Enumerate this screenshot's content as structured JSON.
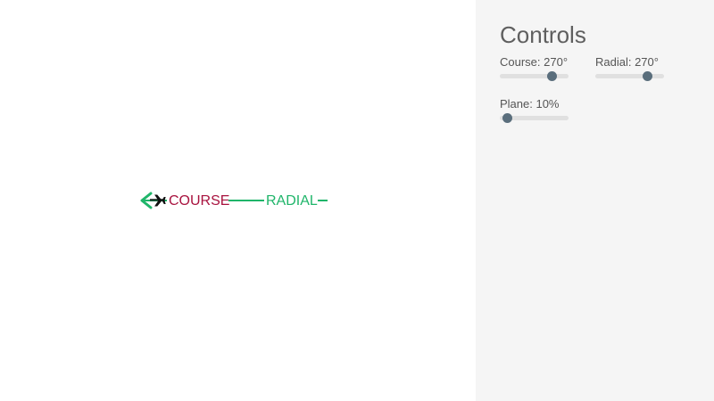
{
  "viz": {
    "course_label": "COURSE",
    "radial_label": "RADIAL",
    "course_color": "#a8123e",
    "radial_color": "#1fb56a",
    "plane_color": "#111111",
    "icons": [
      "plane-icon",
      "arrow-left-icon"
    ]
  },
  "controls": {
    "title": "Controls",
    "course": {
      "label": "Course: 270°",
      "value": 270,
      "min": 0,
      "max": 360
    },
    "radial": {
      "label": "Radial: 270°",
      "value": 270,
      "min": 0,
      "max": 360
    },
    "plane": {
      "label": "Plane: 10%",
      "value": 10,
      "min": 0,
      "max": 100
    },
    "thumb_color": "#5a6e7c",
    "track_color": "#e0e0e0"
  }
}
